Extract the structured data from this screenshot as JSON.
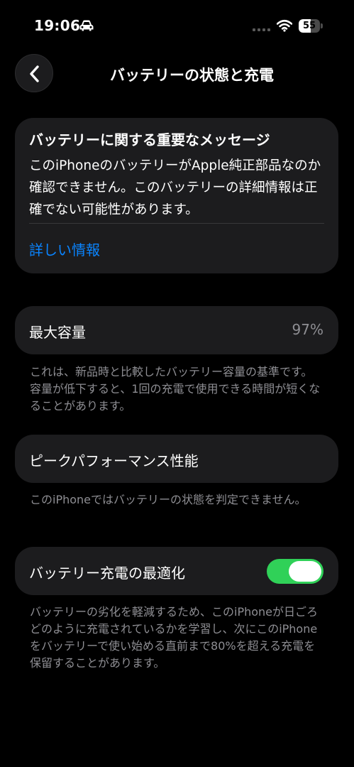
{
  "status_bar": {
    "time": "19:06",
    "battery_level": "55",
    "battery_fraction": 0.55
  },
  "nav": {
    "title": "バッテリーの状態と充電",
    "back_icon": "chevron-left-icon"
  },
  "message_card": {
    "title": "バッテリーに関する重要なメッセージ",
    "body": "このiPhoneのバッテリーがApple純正部品なのか確認できません。このバッテリーの詳細情報は正確でない可能性があります。",
    "link": "詳しい情報"
  },
  "capacity": {
    "label": "最大容量",
    "value": "97%",
    "note": "これは、新品時と比較したバッテリー容量の基準です。容量が低下すると、1回の充電で使用できる時間が短くなることがあります。"
  },
  "peak": {
    "label": "ピークパフォーマンス性能",
    "note": "このiPhoneではバッテリーの状態を判定できません。"
  },
  "optimized_charging": {
    "label": "バッテリー充電の最適化",
    "enabled": true,
    "note": "バッテリーの劣化を軽減するため、このiPhoneが日ごろどのように充電されているかを学習し、次にこのiPhoneをバッテリーで使い始める直前まで80%を超える充電を保留することがあります。"
  },
  "colors": {
    "background": "#000000",
    "card": "#1c1c1e",
    "link": "#0a84ff",
    "toggle_on": "#30d158",
    "secondary_text": "#8e8e93"
  }
}
